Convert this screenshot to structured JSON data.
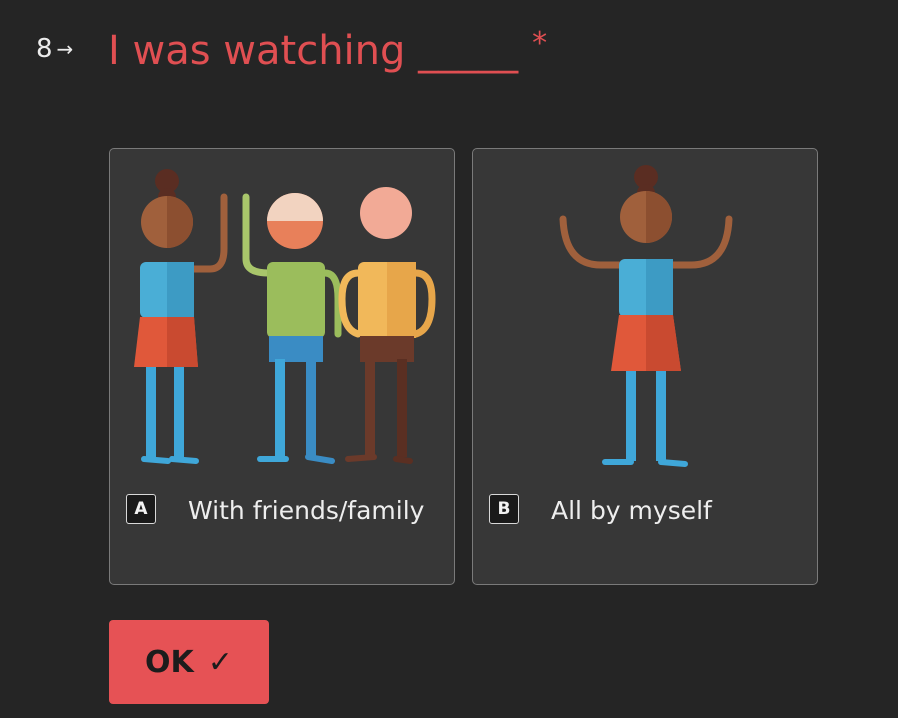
{
  "question": {
    "number": "8",
    "arrow_icon": "→",
    "text": "I was watching _____",
    "required_mark": "*",
    "accent_color": "#e04f52"
  },
  "choices": [
    {
      "key": "A",
      "label": "With friends/family",
      "icon": "group-of-people-illustration"
    },
    {
      "key": "B",
      "label": "All by myself",
      "icon": "single-person-illustration"
    }
  ],
  "ok_button": {
    "label": "OK",
    "icon": "✓"
  }
}
